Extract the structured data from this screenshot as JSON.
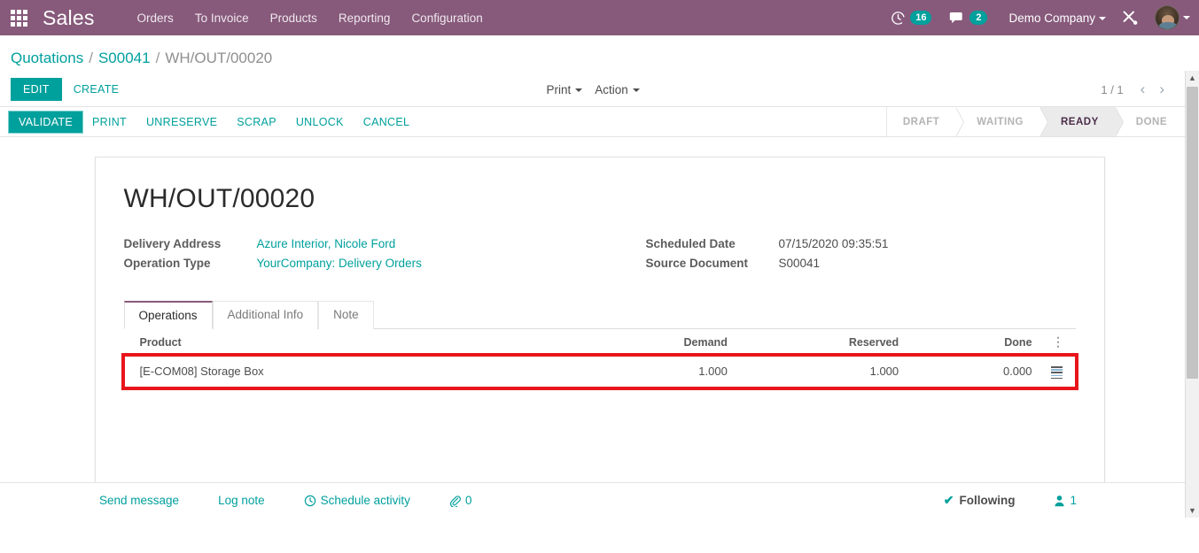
{
  "navbar": {
    "apps_icon": "apps-grid-icon",
    "brand": "Sales",
    "menu": [
      {
        "label": "Orders"
      },
      {
        "label": "To Invoice"
      },
      {
        "label": "Products"
      },
      {
        "label": "Reporting"
      },
      {
        "label": "Configuration"
      }
    ],
    "activities": {
      "icon": "clock-icon",
      "count": "16"
    },
    "messages": {
      "icon": "chat-bubble-icon",
      "count": "2"
    },
    "company": "Demo Company",
    "tools_icon": "tools-wrench-icon",
    "avatar": "user-avatar",
    "purple": "#875A7B",
    "teal": "#00A09D"
  },
  "breadcrumb": {
    "items": [
      {
        "label": "Quotations",
        "link": true
      },
      {
        "label": "S00041",
        "link": true
      },
      {
        "label": "WH/OUT/00020",
        "link": false
      }
    ],
    "separator": "/"
  },
  "control_panel": {
    "edit_label": "EDIT",
    "create_label": "CREATE",
    "print_label": "Print",
    "action_label": "Action",
    "pager_count": "1 / 1",
    "prev_icon": "chevron-left-icon",
    "next_icon": "chevron-right-icon"
  },
  "statusbar": {
    "buttons": [
      {
        "label": "VALIDATE",
        "primary": true
      },
      {
        "label": "PRINT",
        "primary": false
      },
      {
        "label": "UNRESERVE",
        "primary": false
      },
      {
        "label": "SCRAP",
        "primary": false
      },
      {
        "label": "UNLOCK",
        "primary": false
      },
      {
        "label": "CANCEL",
        "primary": false
      }
    ],
    "stages": [
      {
        "label": "DRAFT",
        "active": false
      },
      {
        "label": "WAITING",
        "active": false
      },
      {
        "label": "READY",
        "active": true
      },
      {
        "label": "DONE",
        "active": false
      }
    ]
  },
  "form": {
    "title": "WH/OUT/00020",
    "left_fields": [
      {
        "label": "Delivery Address",
        "value": "Azure Interior, Nicole Ford",
        "link": true
      },
      {
        "label": "Operation Type",
        "value": "YourCompany: Delivery Orders",
        "link": true
      }
    ],
    "right_fields": [
      {
        "label": "Scheduled Date",
        "value": "07/15/2020 09:35:51",
        "link": false
      },
      {
        "label": "Source Document",
        "value": "S00041",
        "link": false
      }
    ],
    "tabs": [
      {
        "label": "Operations",
        "active": true
      },
      {
        "label": "Additional Info",
        "active": false
      },
      {
        "label": "Note",
        "active": false
      }
    ],
    "table": {
      "columns": [
        "Product",
        "Demand",
        "Reserved",
        "Done"
      ],
      "options_icon": "column-options-icon",
      "rows": [
        {
          "product": "[E-COM08] Storage Box",
          "demand": "1.000",
          "reserved": "1.000",
          "done": "0.000",
          "detail_icon": "detailed-operations-icon",
          "highlighted": true,
          "highlight_color": "#e8151a"
        }
      ]
    }
  },
  "chatter": {
    "send_message": "Send message",
    "log_note": "Log note",
    "schedule_activity": "Schedule activity",
    "schedule_icon": "clock-icon",
    "attachment_icon": "paperclip-icon",
    "attachment_count": "0",
    "following_label": "Following",
    "following_icon": "check-icon",
    "followers_icon": "user-icon",
    "followers_count": "1"
  },
  "scrollbar": {
    "up_icon": "chevron-up-icon",
    "down_icon": "chevron-down-icon"
  }
}
